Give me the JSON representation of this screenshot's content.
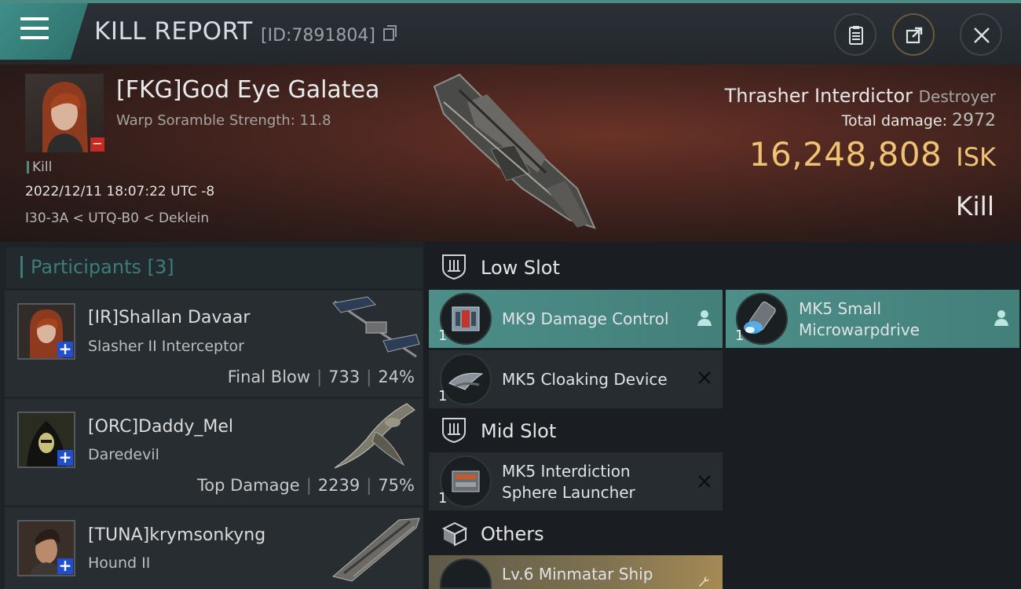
{
  "header": {
    "title": "KILL REPORT",
    "report_id": "[ID:7891804]"
  },
  "victim": {
    "name": "[FKG]God Eye Galatea",
    "subtitle": "Warp Soramble Strength: 11.8",
    "kill_tag": "Kill",
    "datetime": "2022/12/11 18:07:22 UTC -8",
    "location": "I30-3A < UTQ-B0 < Deklein",
    "ship_name": "Thrasher Interdictor",
    "ship_class": "Destroyer",
    "total_damage_label": "Total damage:",
    "total_damage": "2972",
    "isk_value": "16,248,808",
    "isk_unit": "ISK",
    "result_label": "Kill"
  },
  "participants": {
    "title": "Participants",
    "count": "[3]",
    "items": [
      {
        "name": "[IR]Shallan Davaar",
        "ship": "Slasher II Interceptor",
        "stat_label": "Final Blow",
        "damage": "733",
        "percent": "24%"
      },
      {
        "name": "[ORC]Daddy_Mel",
        "ship": "Daredevil",
        "stat_label": "Top Damage",
        "damage": "2239",
        "percent": "75%"
      },
      {
        "name": "[TUNA]krymsonkyng",
        "ship": "Hound II",
        "stat_label": "",
        "damage": "",
        "percent": ""
      }
    ]
  },
  "slots": {
    "low_title": "Low Slot",
    "mid_title": "Mid Slot",
    "others_title": "Others",
    "low_items": [
      {
        "name": "MK9 Damage Control",
        "qty": "1",
        "status": "dropped"
      },
      {
        "name": "MK5 Small Microwarpdrive",
        "name_line1": "MK5 Small",
        "name_line2": "Microwarpdrive",
        "qty": "1",
        "status": "dropped"
      },
      {
        "name": "MK5 Cloaking Device",
        "qty": "1",
        "status": "destroyed"
      }
    ],
    "mid_items": [
      {
        "name_line1": "MK5 Interdiction",
        "name_line2": "Sphere Launcher",
        "qty": "1",
        "status": "destroyed"
      }
    ],
    "other_items": [
      {
        "name": "Lv.6 Minmatar Ship",
        "qty": "",
        "status": "other"
      }
    ]
  }
}
